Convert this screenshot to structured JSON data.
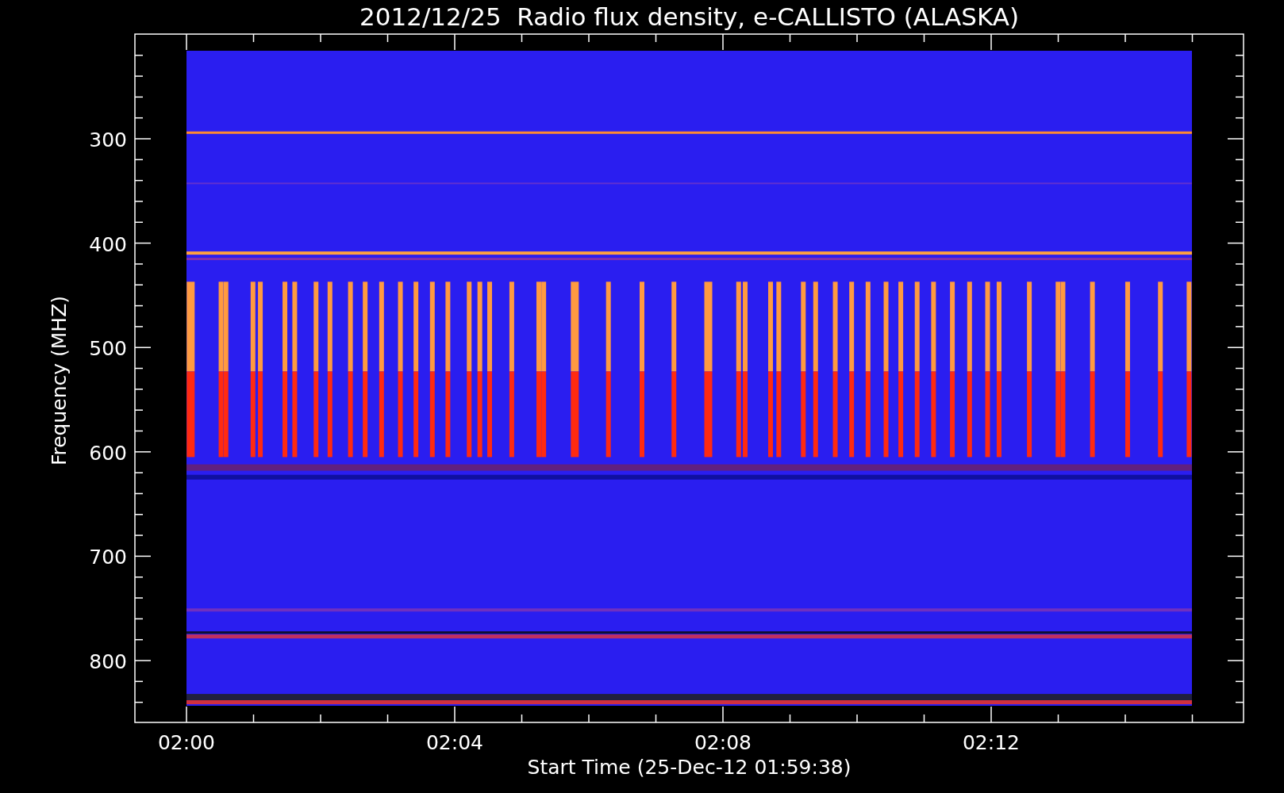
{
  "title": "2012/12/25  Radio flux density, e-CALLISTO (ALASKA)",
  "y_axis": {
    "label": "Frequency (MHZ)",
    "ticks": [
      "300",
      "400",
      "500",
      "600",
      "700",
      "800"
    ]
  },
  "x_axis": {
    "label": "Start Time (25-Dec-12 01:59:38)",
    "ticks": [
      "02:00",
      "02:04",
      "02:08",
      "02:12"
    ]
  }
}
